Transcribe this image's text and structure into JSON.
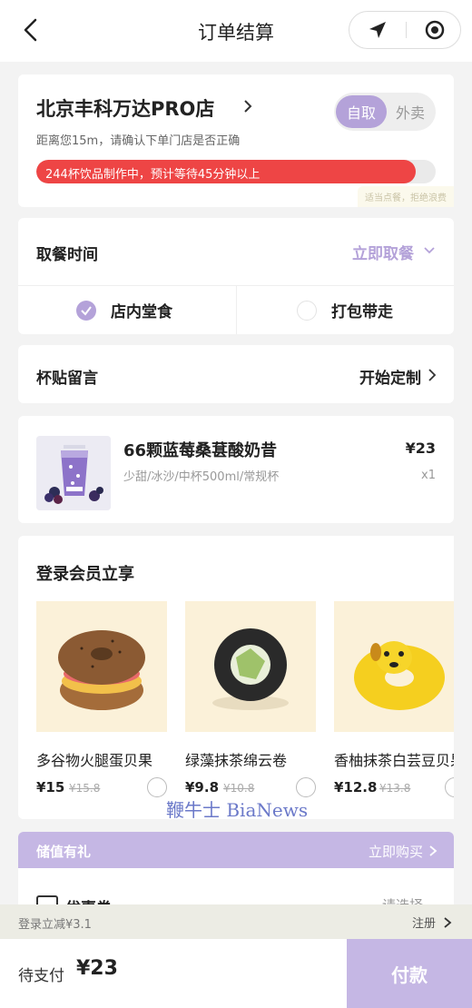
{
  "header": {
    "title": "订单结算"
  },
  "store": {
    "name": "北京丰科万达PRO店",
    "distance_notice": "距离您15m，请确认下单门店是否正确",
    "mode_selected": "自取",
    "mode_other": "外卖",
    "queue_text": "244杯饮品制作中，预计等待45分钟以上",
    "queue_fill": 0.95,
    "hint": "适当点餐，拒绝浪费"
  },
  "pickup": {
    "label": "取餐时间",
    "value": "立即取餐",
    "options": [
      "店内堂食",
      "打包带走"
    ]
  },
  "sticker": {
    "label": "杯贴留言",
    "action": "开始定制"
  },
  "product": {
    "name": "66颗蓝莓桑葚酸奶昔",
    "spec": "少甜/冰沙/中杯500ml/常规杯",
    "price": "¥23",
    "qty": "x1"
  },
  "member": {
    "title": "登录会员立享",
    "items": [
      {
        "name": "多谷物火腿蛋贝果",
        "price": "¥15",
        "orig": "¥15.8"
      },
      {
        "name": "绿藻抹茶绵云卷",
        "price": "¥9.8",
        "orig": "¥10.8"
      },
      {
        "name": "香柚抹茶白芸豆贝果",
        "price": "¥12.8",
        "orig": "¥13.8"
      }
    ]
  },
  "watermark": "鞭牛士 BiaNews",
  "stored_value": {
    "title": "储值有礼",
    "action": "立即购买",
    "coupon_label": "优惠券",
    "coupon_value": "请选择"
  },
  "login_bar": {
    "text": "登录立减¥3.1",
    "register": "注册"
  },
  "pay": {
    "label": "待支付",
    "total": "¥23",
    "button": "付款"
  },
  "colors": {
    "accent": "#b4a2d9",
    "accent_light": "#c5b7e4",
    "progress": "#ee4545"
  }
}
